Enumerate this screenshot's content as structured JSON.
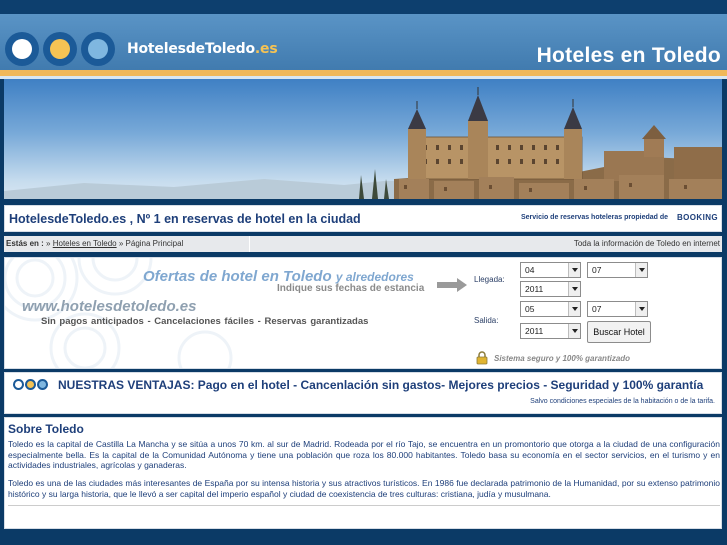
{
  "brand": {
    "name": "HotelesdeToledo",
    "tld": ".es"
  },
  "header": {
    "title": "Hoteles en Toledo"
  },
  "strap": {
    "title": "HotelesdeToledo.es , Nº 1 en reservas de hotel en la ciudad",
    "service": "Servicio de reservas hoteleras propiedad de",
    "booking": "BOOKING"
  },
  "breadcrumb": {
    "label": "Estás en :",
    "sep1": "»",
    "link": "Hoteles en Toledo",
    "sep2": "»",
    "current": "Página Principal",
    "right": "Toda la información de Toledo en internet"
  },
  "search": {
    "title": "Ofertas de hotel en Toledo",
    "title_suffix": "y alrededores",
    "subtitle": "Indique sus fechas de estancia",
    "url": "www.hotelesdetoledo.es",
    "perks": "Sin pagos anticipados  -  Cancelaciones fáciles  -  Reservas garantizadas",
    "checkin_label": "Llegada:",
    "checkout_label": "Salida:",
    "checkin_day": "04",
    "checkin_month": "07",
    "checkin_year": "2011",
    "checkout_day": "05",
    "checkout_month": "07",
    "checkout_year": "2011",
    "button": "Buscar Hotel",
    "secure": "Sistema seguro y 100% garantizado"
  },
  "advantages": {
    "title": "NUESTRAS VENTAJAS: Pago en el hotel - Cancenlación sin gastos- Mejores precios - Seguridad y 100% garantía",
    "note": "Salvo condiciones especiales de la habitación o de la tarifa."
  },
  "about": {
    "heading": "Sobre Toledo",
    "p1": "Toledo es la capital de Castilla La Mancha y se sitúa a unos 70 km. al sur de Madrid. Rodeada por el río Tajo, se encuentra en un promontorio que otorga a la ciudad de una configuración especialmente bella. Es la capital de la Comunidad Autónoma y tiene una población que roza los 80.000 habitantes. Toledo basa su economía en el sector servicios, en el turismo y en actividades industriales, agrícolas y ganaderas.",
    "p2": "Toledo es una de las ciudades más interesantes de España por su intensa historia y sus atractivos turísticos. En 1986 fue declarada patrimonio de la Humanidad, por su extenso patrimonio histórico y su larga historia, que le llevó a ser capital del imperio español y ciudad de coexistencia de tres culturas: cristiana, judía y musulmana."
  },
  "colors": {
    "navy": "#0b3a66",
    "accent_gold": "#f0b85a",
    "text_blue": "#1e3f7a"
  }
}
